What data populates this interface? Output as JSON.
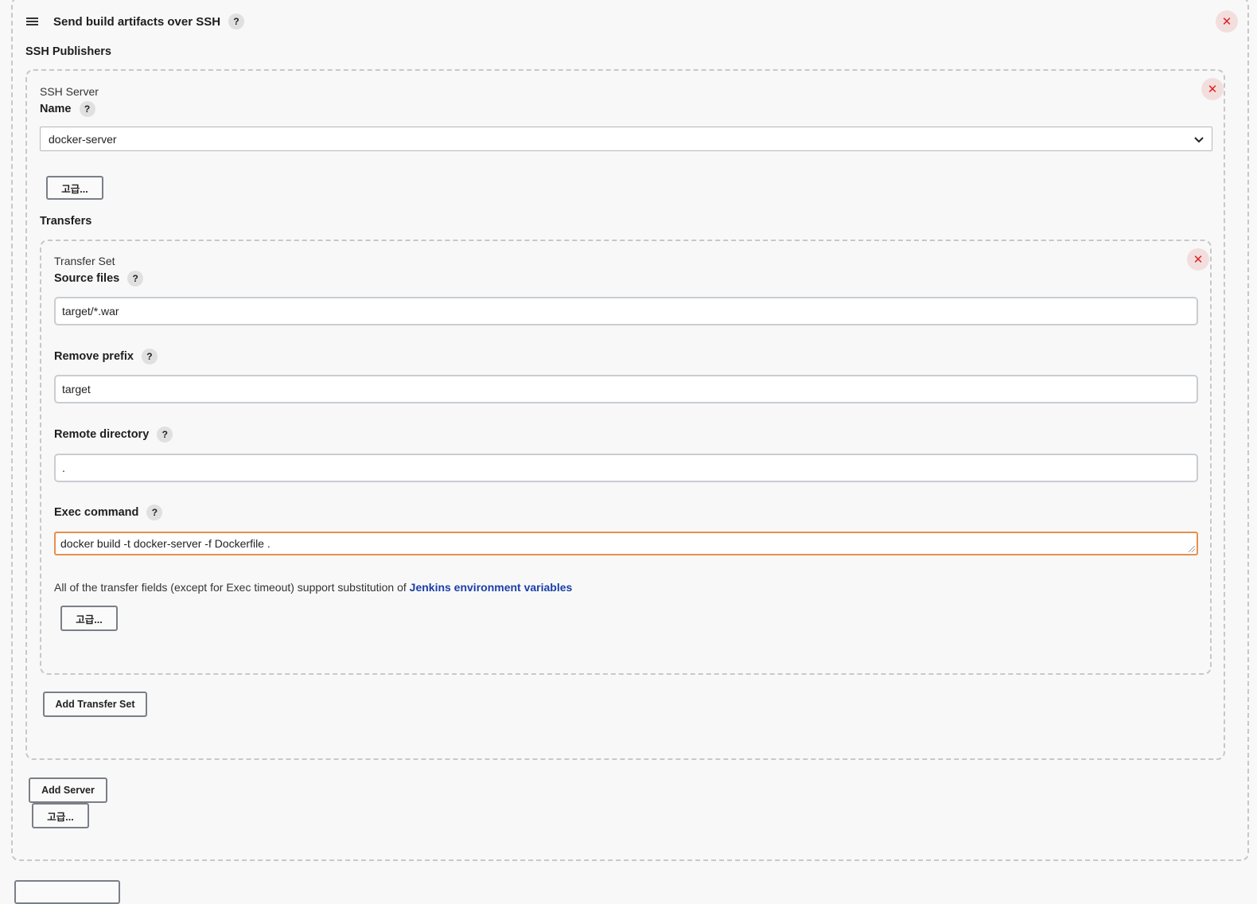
{
  "step": {
    "title": "Send build artifacts over SSH",
    "help": "?",
    "close": "✕",
    "section_label": "SSH Publishers",
    "add_server_label": "Add Server",
    "advanced_label": "고급..."
  },
  "server": {
    "title": "SSH Server",
    "name_label": "Name",
    "help": "?",
    "close": "✕",
    "name_value": "docker-server",
    "advanced_label": "고급...",
    "transfers_label": "Transfers",
    "add_transfer_label": "Add Transfer Set"
  },
  "transfer": {
    "title": "Transfer Set",
    "close": "✕",
    "help": "?",
    "source_label": "Source files",
    "source_value": "target/*.war",
    "prefix_label": "Remove prefix",
    "prefix_value": "target",
    "remote_label": "Remote directory",
    "remote_value": ".",
    "exec_label": "Exec command",
    "exec_value": "docker build -t docker-server -f Dockerfile .",
    "note_text": "All of the transfer fields (except for Exec timeout) support substitution of ",
    "note_link": "Jenkins environment variables",
    "advanced_label": "고급..."
  },
  "colors": {
    "accent_focus": "#e5904f",
    "link": "#1a3ea8",
    "close": "#d22222"
  }
}
